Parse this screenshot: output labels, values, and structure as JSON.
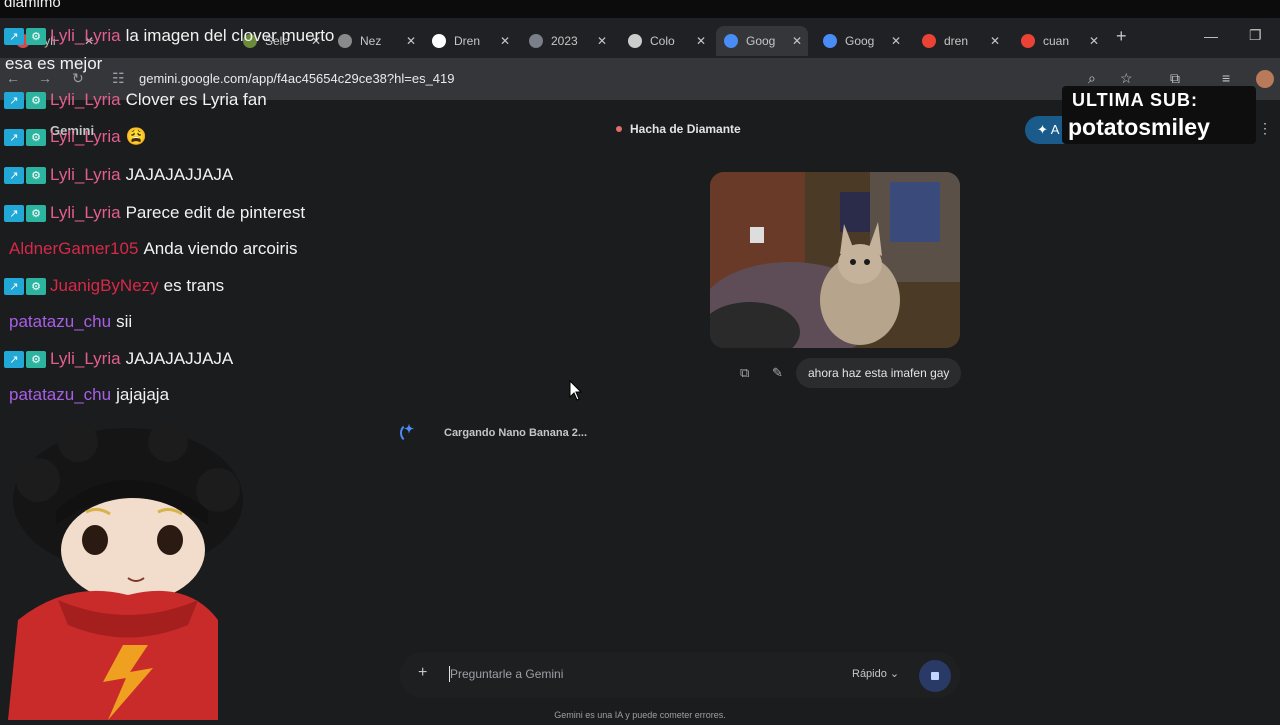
{
  "stream_top_text": "diamimo",
  "tabs": [
    {
      "label": "Lyli",
      "color": "#e04545"
    },
    {
      "label": "Sele",
      "color": "#6a8a3c"
    },
    {
      "label": "Nez",
      "color": "#8a8a8a"
    },
    {
      "label": "Dren",
      "color": "#ffffff"
    },
    {
      "label": "2023",
      "color": "#7a7f8a"
    },
    {
      "label": "Colo",
      "color": "#cccccc"
    },
    {
      "label": "Goog",
      "color": "#4a8cf5"
    },
    {
      "label": "Goog",
      "color": "#4a8cf5"
    },
    {
      "label": "dren",
      "color": "#ea4335"
    },
    {
      "label": "cuan",
      "color": "#ea4335"
    }
  ],
  "browser": {
    "url": "gemini.google.com/app/f4ac45654c29ce38?hl=es_419",
    "new_tab_label": "+"
  },
  "gemini": {
    "brand": "Gemini",
    "chat_title": "Hacha de Diamante",
    "user_prompt": "ahora haz esta imafen gay",
    "loading_text": "Cargando Nano Banana 2...",
    "input_placeholder": "Preguntarle a Gemini",
    "mode_label": "Rápido",
    "footer": "Gemini es una IA y puede cometer errores.",
    "upgrade_label": "✦ A"
  },
  "overlay": {
    "sub_title": "ULTIMA SUB:",
    "sub_name": "potatosmiley"
  },
  "chat": [
    {
      "user": "Lyli_Lyria",
      "text": "la imagen del clover muerto",
      "color": "#e35d8f",
      "badges": true
    },
    {
      "user": "",
      "text": "esa es mejor",
      "color": "#e35d8f",
      "badges": false
    },
    {
      "user": "Lyli_Lyria",
      "text": "Clover es Lyria fan",
      "color": "#e35d8f",
      "badges": true
    },
    {
      "user": "Lyli_Lyria",
      "text": "😩",
      "color": "#e35d8f",
      "badges": true
    },
    {
      "user": "Lyli_Lyria",
      "text": "JAJAJAJJAJA",
      "color": "#e35d8f",
      "badges": true
    },
    {
      "user": "Lyli_Lyria",
      "text": "Parece edit de pinterest",
      "color": "#e35d8f",
      "badges": true
    },
    {
      "user": "AldnerGamer105",
      "text": "Anda viendo arcoiris",
      "color": "#d8284a",
      "badges": false
    },
    {
      "user": "JuanigByNezy",
      "text": "es trans",
      "color": "#d8284a",
      "badges": true
    },
    {
      "user": "patatazu_chu",
      "text": "sii",
      "color": "#a95ee8",
      "badges": false
    },
    {
      "user": "Lyli_Lyria",
      "text": "JAJAJAJJAJA",
      "color": "#e35d8f",
      "badges": true
    },
    {
      "user": "patatazu_chu",
      "text": "jajajaja",
      "color": "#a95ee8",
      "badges": false
    }
  ]
}
